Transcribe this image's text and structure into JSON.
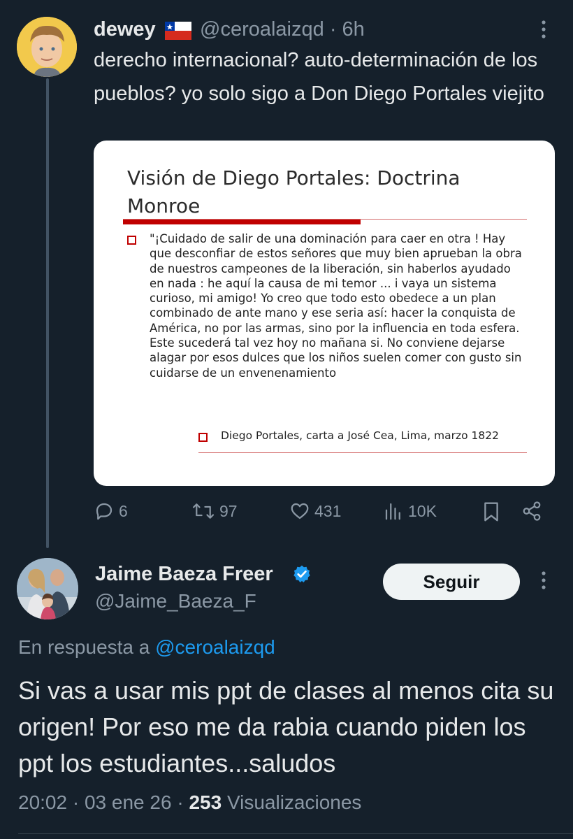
{
  "tweet1": {
    "author_name": "dewey",
    "author_handle": "@ceroalaizqd",
    "time": "6h",
    "text": "derecho internacional? auto-determinación de los pueblos? yo solo sigo a Don Diego Portales viejito",
    "slide": {
      "title": "Visión de Diego Portales: Doctrina Monroe",
      "quote": "\"¡Cuidado de salir de una dominación para caer en otra ! Hay que desconfiar de estos señores que muy bien  aprueban la obra de nuestros campeones de la liberación, sin haberlos ayudado en nada : he aquí la causa de mi temor ... i vaya un sistema curioso, mi amigo! Yo creo que todo esto obedece a un plan combinado de ante mano y ese seria así: hacer la conquista de América, no por las armas, sino por la influencia en toda esfera. Este sucederá tal vez hoy no mañana si. No conviene dejarse alagar por esos dulces que los niños suelen comer con gusto sin cuidarse de un envenenamiento",
      "citation": "Diego Portales, carta a José Cea, Lima, marzo 1822",
      "accent_color": "#c00000"
    },
    "stats": {
      "replies": "6",
      "reposts": "97",
      "likes": "431",
      "views": "10K"
    }
  },
  "tweet2": {
    "author_name": "Jaime Baeza Freer",
    "author_handle": "@Jaime_Baeza_F",
    "follow_label": "Seguir",
    "reply_prefix": "En respuesta a",
    "reply_handle": "@ceroalaizqd",
    "text": "Si vas a usar mis ppt de clases al menos cita su origen! Por eso me da rabia cuando piden los ppt los estudiantes...saludos",
    "time": "20:02",
    "date": "03 ene 26",
    "views_count": "253",
    "views_label": "Visualizaciones"
  },
  "colors": {
    "background": "#15202b",
    "text_primary": "#e7e9ea",
    "text_secondary": "#8b98a5",
    "link": "#1d9bf0",
    "verified": "#1d9bf0"
  }
}
